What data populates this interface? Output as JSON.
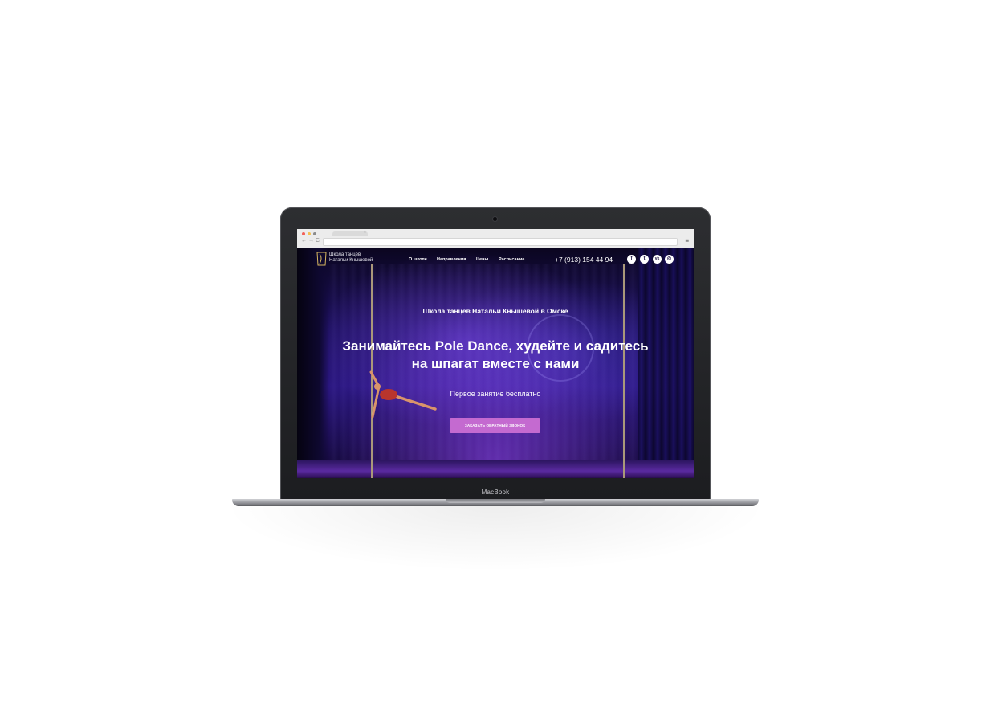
{
  "device": {
    "label": "MacBook"
  },
  "browser": {
    "tab_close": "×",
    "back": "←",
    "forward": "→",
    "reload": "C",
    "menu": "≡"
  },
  "site": {
    "logo_line1": "Школа танцев",
    "logo_line2": "Натальи Кнышевой",
    "nav": [
      "О школе",
      "Направления",
      "Цены",
      "Расписание"
    ],
    "phone": "+7 (913) 154 44 94",
    "social": [
      {
        "icon": "facebook-icon",
        "glyph": "f"
      },
      {
        "icon": "twitter-icon",
        "glyph": "t"
      },
      {
        "icon": "vk-icon",
        "glyph": "vk"
      },
      {
        "icon": "instagram-icon",
        "glyph": "◎"
      }
    ]
  },
  "hero": {
    "subtitle": "Школа танцев Натальи Кнышевой в Омске",
    "headline_line1": "Занимайтесь Pole Dance, худейте и садитесь",
    "headline_line2": "на шпагат вместе с нами",
    "offer": "Первое занятие бесплатно",
    "cta_label": "Заказать обратный звонок"
  },
  "colors": {
    "accent": "#c46ad0",
    "hero_bg": "#1d1060",
    "laptop": "#2d2e31"
  }
}
